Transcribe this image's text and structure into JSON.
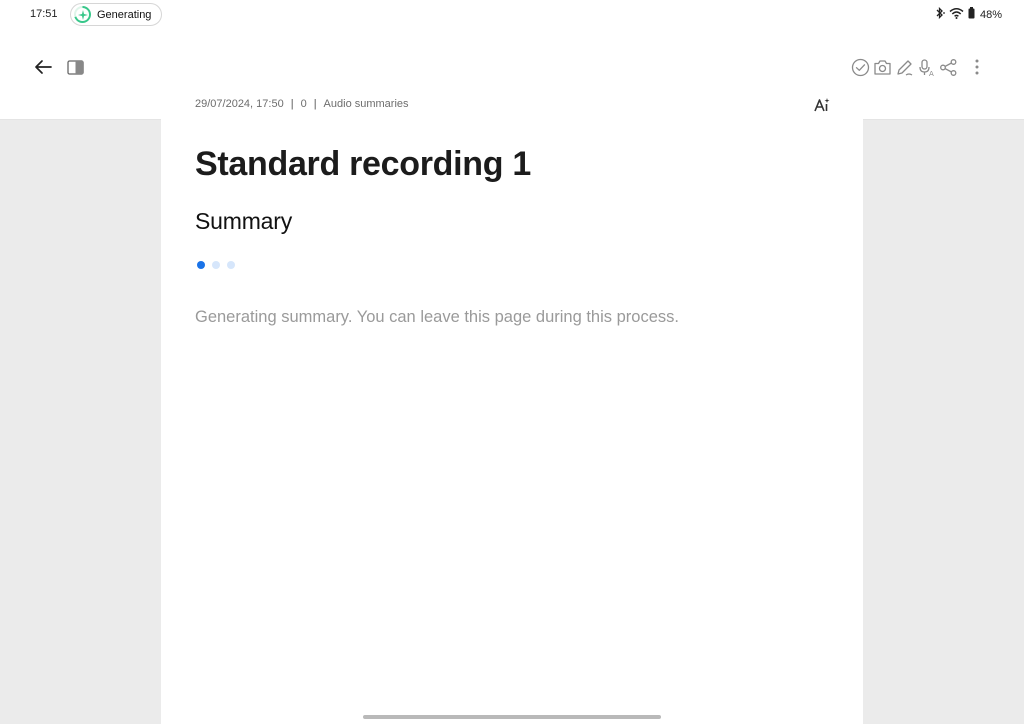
{
  "status_bar": {
    "time": "17:51",
    "pill_label": "Generating",
    "battery": "48%"
  },
  "meta": {
    "timestamp": "29/07/2024, 17:50",
    "count": "0",
    "category": "Audio summaries"
  },
  "document": {
    "title": "Standard recording 1",
    "heading": "Summary",
    "progress_message": "Generating summary. You can leave this page during this process."
  },
  "icons": {
    "back": "arrow-left-icon",
    "sidebar": "sidebar-toggle-icon",
    "check": "check-circle-icon",
    "camera": "camera-icon",
    "pen": "pen-icon",
    "transcribe": "mic-transcribe-icon",
    "share": "share-icon",
    "more": "more-vertical-icon",
    "ai": "ai-sparkle-icon"
  },
  "colors": {
    "accent": "#1a73e8",
    "dot_inactive": "#d6e6fb",
    "spark": "#37c78a",
    "content_bg": "#ebebeb"
  }
}
